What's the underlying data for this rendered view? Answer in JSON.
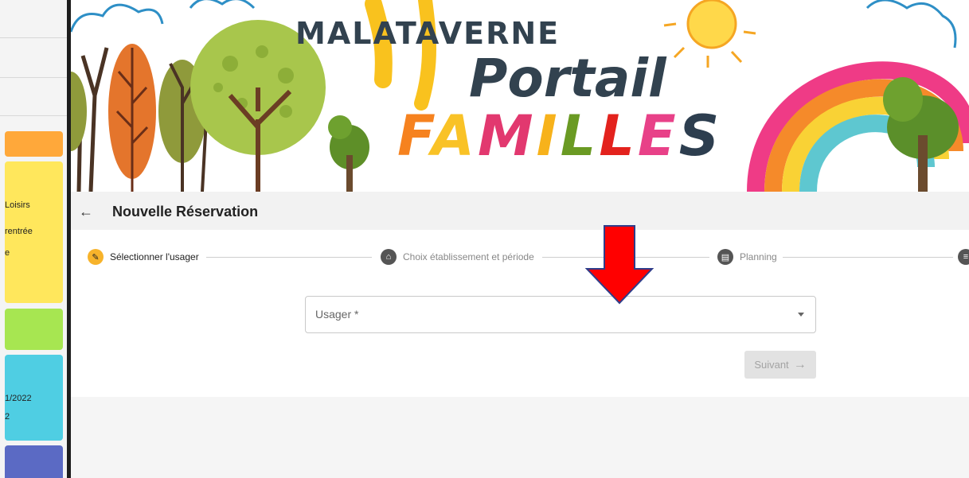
{
  "left_panel": {
    "texts": [
      "Loisirs",
      "rentrée",
      "e",
      "1/2022",
      "2"
    ],
    "card_colors": [
      "#ffa83a",
      "#ffe75c",
      "#a7e651",
      "#4fcee3",
      "#5b6ac4"
    ]
  },
  "banner": {
    "brand_top": "MALATAVERNE",
    "brand_mid": "Portail",
    "brand_bottom_letters": [
      {
        "ch": "F",
        "color": "#f6821f"
      },
      {
        "ch": "A",
        "color": "#f9c226"
      },
      {
        "ch": "M",
        "color": "#e2386f"
      },
      {
        "ch": "I",
        "color": "#f7b21b"
      },
      {
        "ch": "L",
        "color": "#6a9a23"
      },
      {
        "ch": "L",
        "color": "#e3221d"
      },
      {
        "ch": "E",
        "color": "#e84188"
      },
      {
        "ch": "S",
        "color": "#2d3e4f"
      }
    ]
  },
  "header": {
    "back_icon": "arrow-left-icon",
    "title": "Nouvelle Réservation"
  },
  "stepper": {
    "steps": [
      {
        "label": "Sélectionner l'usager",
        "icon": "pencil-icon",
        "active": true
      },
      {
        "label": "Choix établissement et période",
        "icon": "home-icon",
        "active": false
      },
      {
        "label": "Planning",
        "icon": "calendar-icon",
        "active": false
      },
      {
        "label": "",
        "icon": "list-icon",
        "active": false
      }
    ]
  },
  "form": {
    "usager_label": "Usager *",
    "next_label": "Suivant"
  },
  "colors": {
    "active_step": "#f7b32b",
    "inactive_step": "#555555",
    "annotation_arrow": "#ff0000"
  }
}
